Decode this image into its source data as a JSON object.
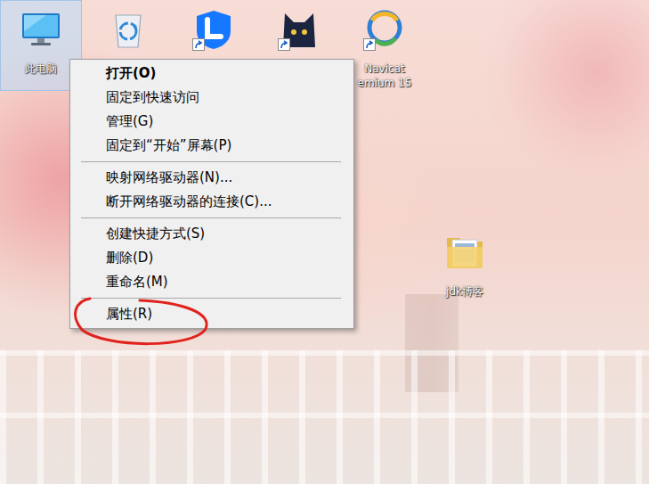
{
  "desktop": {
    "top_row": [
      {
        "kind": "computer",
        "label": "此电脑",
        "selected": true,
        "shortcut": false
      },
      {
        "kind": "recycle-bin",
        "selected": false,
        "shortcut": false
      },
      {
        "kind": "blue-app",
        "selected": false,
        "shortcut": true
      },
      {
        "kind": "cat-app",
        "selected": false,
        "shortcut": true
      },
      {
        "kind": "navicat",
        "label": "Navicat\nemium 15",
        "selected": false,
        "shortcut": true
      }
    ],
    "folder": {
      "label": "jdk博客",
      "selected": false
    }
  },
  "context_menu": {
    "groups": [
      [
        {
          "label": "打开(O)",
          "default": true,
          "circled": false
        },
        {
          "label": "固定到快速访问",
          "default": false,
          "circled": false
        },
        {
          "label": "管理(G)",
          "default": false,
          "circled": false
        },
        {
          "label": "固定到“开始”屏幕(P)",
          "default": false,
          "circled": false
        }
      ],
      [
        {
          "label": "映射网络驱动器(N)...",
          "default": false,
          "circled": false
        },
        {
          "label": "断开网络驱动器的连接(C)...",
          "default": false,
          "circled": false
        }
      ],
      [
        {
          "label": "创建快捷方式(S)",
          "default": false,
          "circled": false
        },
        {
          "label": "删除(D)",
          "default": false,
          "circled": false
        },
        {
          "label": "重命名(M)",
          "default": false,
          "circled": false
        }
      ],
      [
        {
          "label": "属性(R)",
          "default": false,
          "circled": true
        }
      ]
    ]
  }
}
